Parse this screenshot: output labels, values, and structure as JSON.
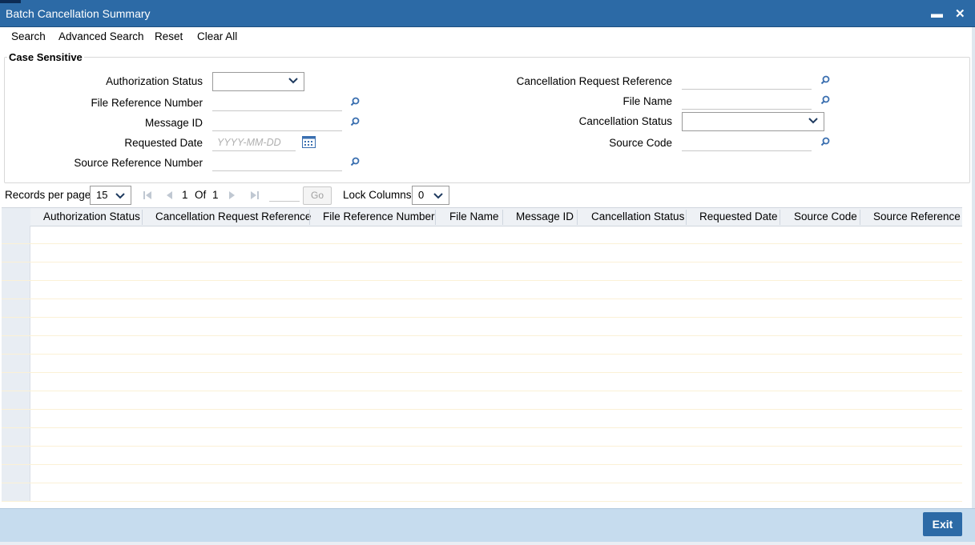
{
  "window": {
    "title": "Batch Cancellation Summary",
    "minimize_glyph": "▬",
    "close_glyph": "✕"
  },
  "toolbar": {
    "search": "Search",
    "advanced_search": "Advanced Search",
    "reset": "Reset",
    "clear_all": "Clear All"
  },
  "criteria": {
    "legend": "Case Sensitive",
    "authorization_status_label": "Authorization Status",
    "file_reference_number_label": "File Reference Number",
    "message_id_label": "Message ID",
    "requested_date_label": "Requested Date",
    "requested_date_placeholder": "YYYY-MM-DD",
    "source_reference_number_label": "Source Reference Number",
    "cancellation_request_reference_label": "Cancellation Request Reference",
    "file_name_label": "File Name",
    "cancellation_status_label": "Cancellation Status",
    "source_code_label": "Source Code"
  },
  "pager": {
    "records_per_page_label": "Records per page",
    "records_per_page_value": "15",
    "current_page": "1",
    "of_label": "Of",
    "total_pages": "1",
    "go_label": "Go",
    "lock_columns_label": "Lock Columns",
    "lock_columns_value": "0"
  },
  "table": {
    "columns": [
      "Authorization Status",
      "Cancellation Request Reference",
      "File Reference Number",
      "File Name",
      "Message ID",
      "Cancellation Status",
      "Requested Date",
      "Source Code",
      "Source Reference N"
    ],
    "row_count": 15
  },
  "footer": {
    "exit_label": "Exit"
  },
  "colors": {
    "title_bar": "#2c6aa6",
    "footer": "#c6dcee",
    "icon_blue": "#3a6fb0"
  },
  "icons": {
    "lookup": "search-icon",
    "calendar": "calendar-icon",
    "dropdown": "chevron-down-icon"
  }
}
